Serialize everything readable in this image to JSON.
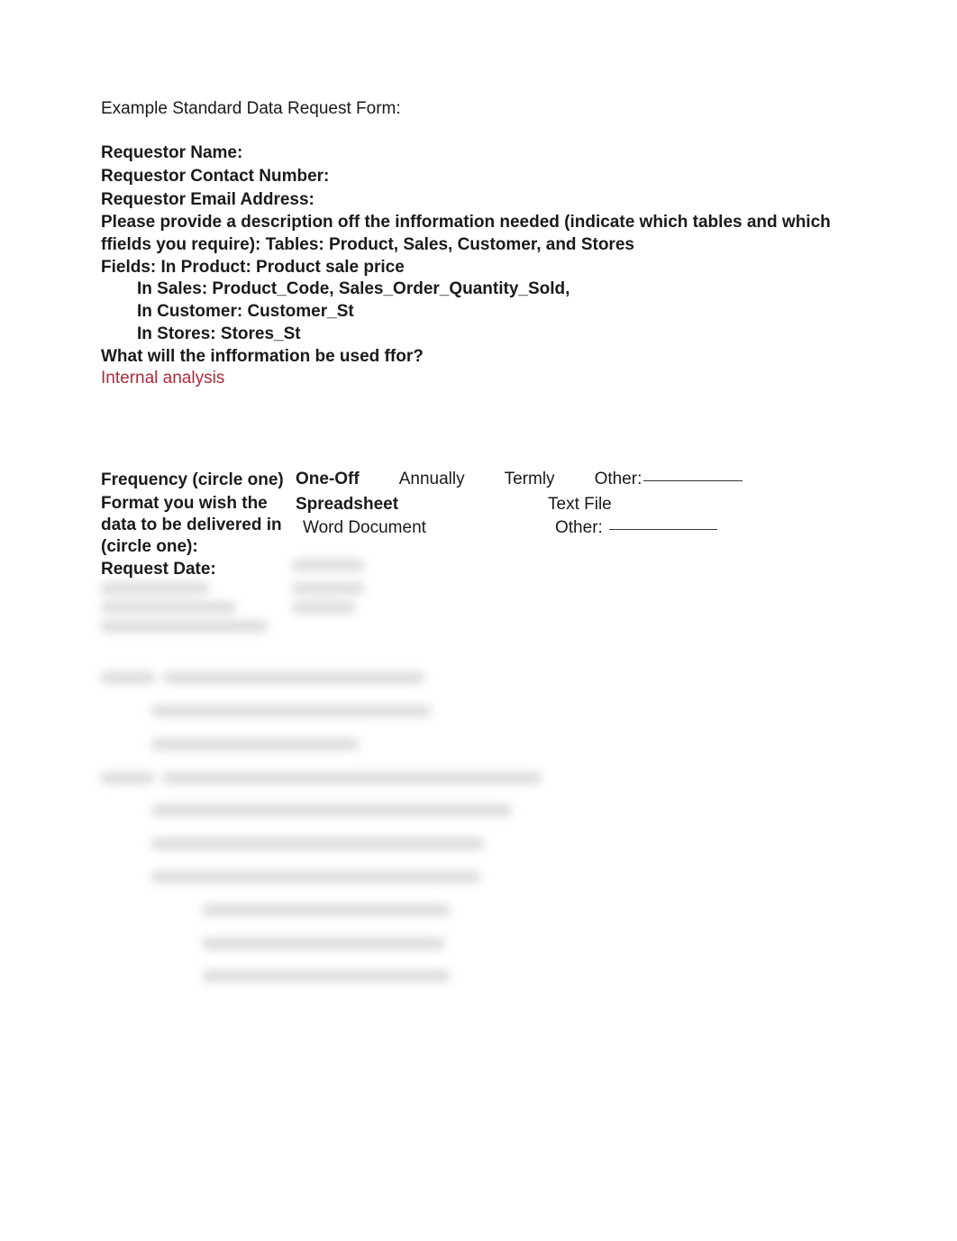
{
  "title": "Example Standard Data Request Form:",
  "labels": {
    "requestor_name": "Requestor Name:",
    "requestor_contact": "Requestor Contact Number:",
    "requestor_email": "Requestor Email Address:",
    "description_lead": "Please provide a description off the infformation needed (indicate which tables and which ffields you require): Tables: Product, Sales, Customer, and Stores",
    "fields_line": "Fields: In Product: Product sale price",
    "fields_sales": "In Sales: Product_Code, Sales_Order_Quantity_Sold,",
    "fields_customer": "In Customer: Customer_St",
    "fields_stores": "In Stores: Stores_St",
    "used_for_q": "What will the infformation be used ffor?",
    "used_for_answer": "Internal analysis",
    "frequency": "Frequency (circle one)",
    "format": "Format you wish the data to be delivered in (circle one):",
    "request_date": "Request Date:"
  },
  "frequency_options": {
    "one_off": "One-Off",
    "annually": "Annually",
    "termly": "Termly",
    "other": "Other:"
  },
  "format_options": {
    "spreadsheet": "Spreadsheet",
    "word_document": "Word Document",
    "text_file": "Text File",
    "other": "Other:"
  }
}
